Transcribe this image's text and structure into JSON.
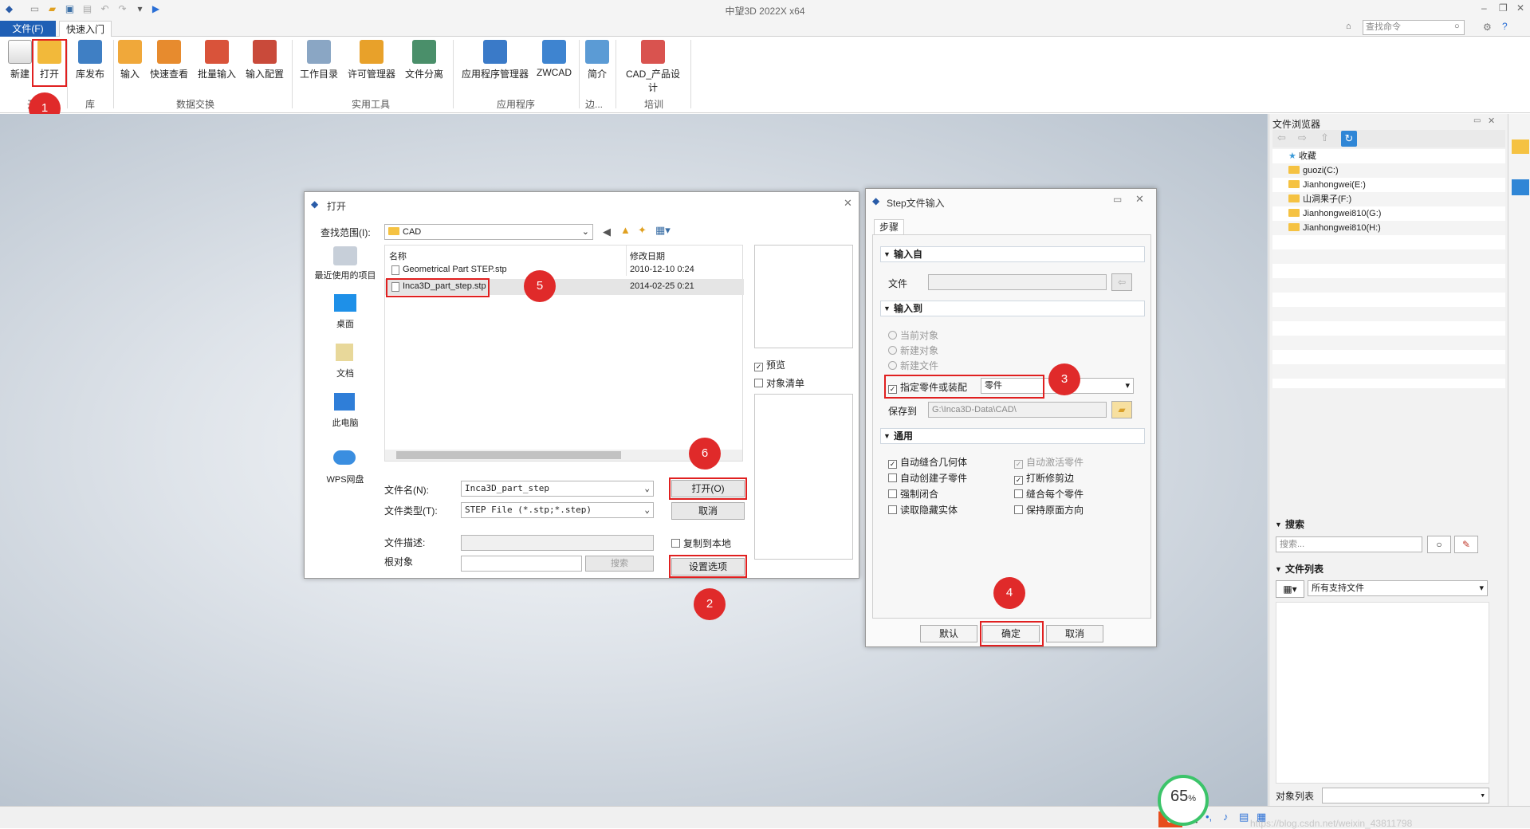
{
  "window": {
    "title": "中望3D 2022X x64"
  },
  "tabs": {
    "file": "文件(F)",
    "quick_start": "快速入门"
  },
  "command_search": {
    "placeholder": "查找命令"
  },
  "ribbon": {
    "buttons": [
      "新建",
      "打开",
      "库发布",
      "输入",
      "快速查看",
      "批量输入",
      "输入配置",
      "工作目录",
      "许可管理器",
      "文件分离",
      "应用程序管理器",
      "ZWCAD",
      "简介",
      "CAD_产品设计"
    ],
    "groups": [
      "开",
      "库",
      "数据交换",
      "实用工具",
      "应用程序",
      "边...",
      "培训"
    ]
  },
  "open_dialog": {
    "title": "打开",
    "look_in_label": "查找范围(I):",
    "look_in_value": "CAD",
    "places": [
      "最近使用的项目",
      "桌面",
      "文档",
      "此电脑",
      "WPS网盘"
    ],
    "columns": {
      "name": "名称",
      "modified": "修改日期"
    },
    "files": [
      {
        "name": "Geometrical Part STEP.stp",
        "modified": "2010-12-10 0:24"
      },
      {
        "name": "Inca3D_part_step.stp",
        "modified": "2014-02-25 0:21"
      }
    ],
    "preview_label": "预览",
    "object_list_label": "对象清单",
    "filename_label": "文件名(N):",
    "filename_value": "Inca3D_part_step",
    "filetype_label": "文件类型(T):",
    "filetype_value": "STEP File (*.stp;*.step)",
    "description_label": "文件描述:",
    "root_label": "根对象",
    "search_button": "搜索",
    "copy_local_label": "复制到本地",
    "open_button": "打开(O)",
    "cancel_button": "取消",
    "settings_button": "设置选项"
  },
  "step_dialog": {
    "title": "Step文件输入",
    "tab": "步骤",
    "input_from": {
      "header": "输入自",
      "file_label": "文件"
    },
    "input_to": {
      "header": "输入到",
      "radios": [
        "当前对象",
        "新建对象",
        "新建文件"
      ],
      "specify_label": "指定零件或装配",
      "specify_value": "零件",
      "save_label": "保存到",
      "save_value": "G:\\Inca3D-Data\\CAD\\"
    },
    "general": {
      "header": "通用",
      "left": [
        {
          "label": "自动缝合几何体",
          "checked": true
        },
        {
          "label": "自动创建子零件",
          "checked": false
        },
        {
          "label": "强制闭合",
          "checked": false
        },
        {
          "label": "读取隐藏实体",
          "checked": false
        }
      ],
      "right": [
        {
          "label": "自动激活零件",
          "checked": true,
          "disabled": true
        },
        {
          "label": "打断修剪边",
          "checked": true
        },
        {
          "label": "缝合每个零件",
          "checked": false
        },
        {
          "label": "保持原面方向",
          "checked": false
        }
      ]
    },
    "buttons": {
      "default": "默认",
      "ok": "确定",
      "cancel": "取消"
    }
  },
  "file_browser": {
    "title": "文件浏览器",
    "tree": [
      "收藏",
      "guozi(C:)",
      "Jianhongwei(E:)",
      "山洞果子(F:)",
      "Jianhongwei810(G:)",
      "Jianhongwei810(H:)"
    ],
    "search_header": "搜索",
    "search_placeholder": "搜索...",
    "filelist_header": "文件列表",
    "filter_value": "所有支持文件",
    "objectlist_label": "对象列表"
  },
  "annotations": [
    "1",
    "2",
    "3",
    "4",
    "5",
    "6"
  ],
  "progress": {
    "value": "65",
    "unit": "%"
  },
  "watermark": "https://blog.csdn.net/weixin_43811798",
  "ime": {
    "lang": "英"
  }
}
